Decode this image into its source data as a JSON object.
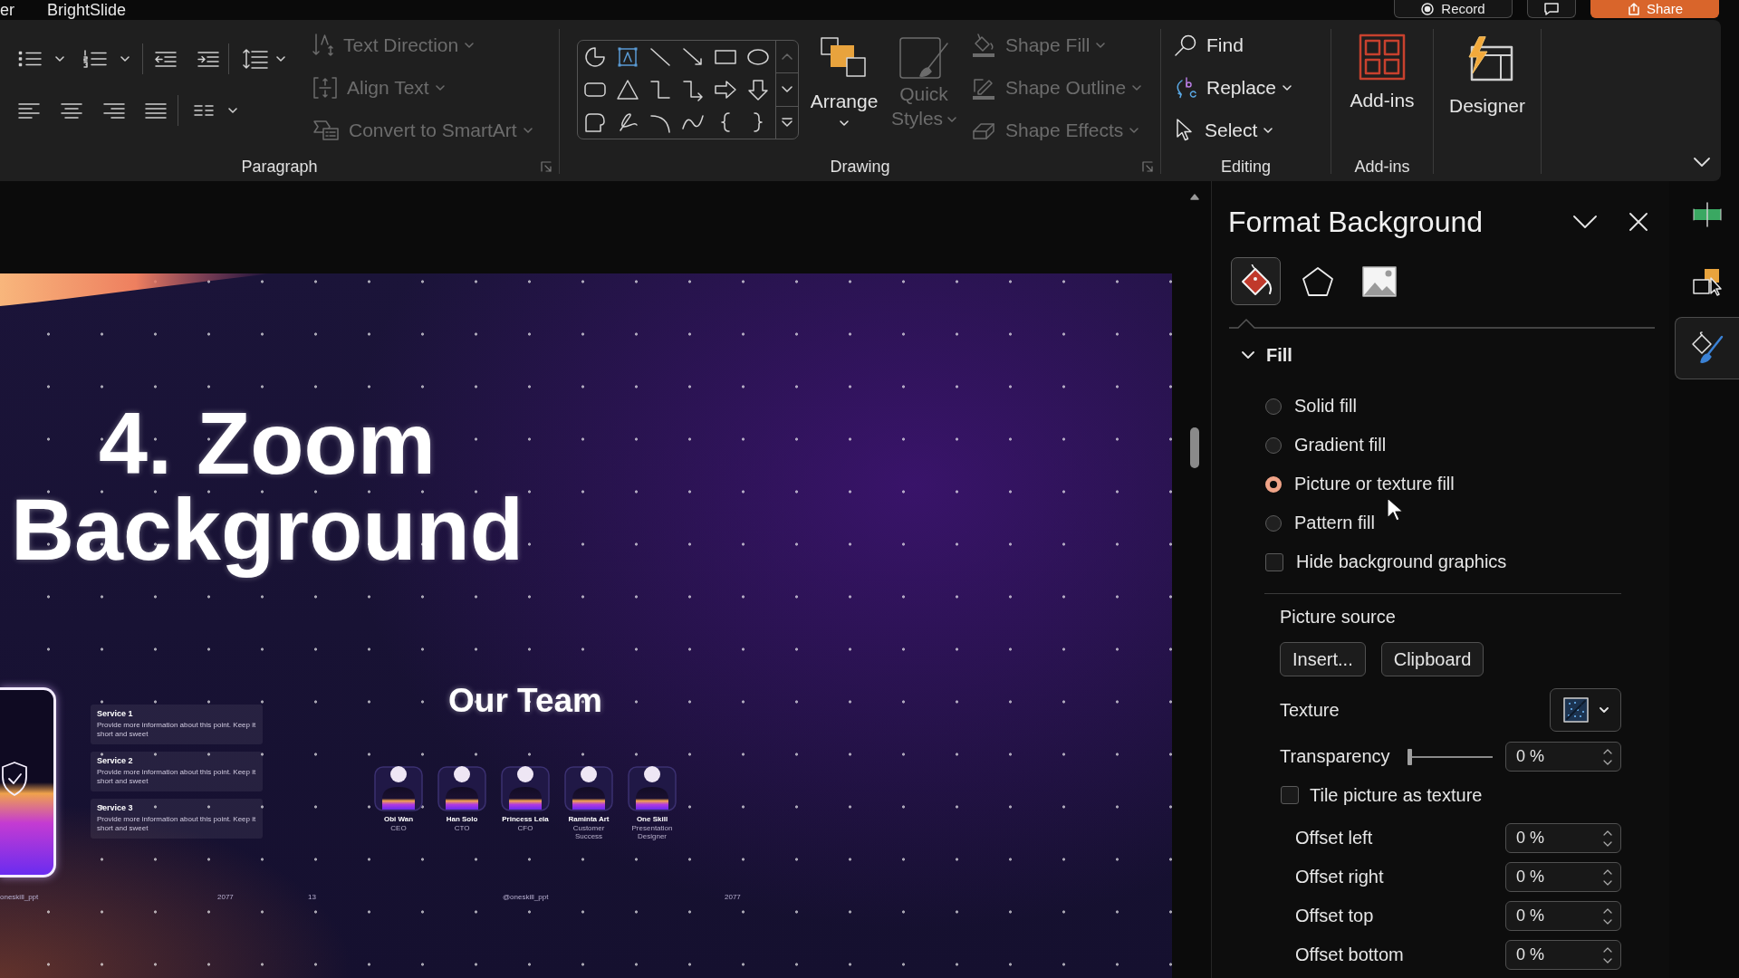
{
  "title_bar": {
    "tabs": [
      {
        "label": "er"
      },
      {
        "label": "BrightSlide"
      }
    ],
    "buttons": [
      {
        "kind": "record",
        "label": "Record"
      },
      {
        "kind": "comments"
      },
      {
        "kind": "share",
        "label": "Share"
      }
    ]
  },
  "ribbon": {
    "groups": [
      {
        "kind": "paragraph",
        "label": "Paragraph",
        "commands": [
          {
            "kind": "direction",
            "label": "Text Direction",
            "disabled": true,
            "dropdown": true
          },
          {
            "kind": "align",
            "label": "Align Text",
            "disabled": true,
            "dropdown": true
          },
          {
            "kind": "smartart",
            "label": "Convert to SmartArt",
            "disabled": true,
            "dropdown": true
          }
        ]
      },
      {
        "kind": "drawing",
        "label": "Drawing",
        "large": [
          {
            "kind": "arrange",
            "label": "Arrange",
            "disabled": false,
            "dropdown": true
          },
          {
            "kind": "styles",
            "label": "Quick Styles",
            "disabled": true,
            "dropdown": true
          }
        ],
        "commands": [
          {
            "kind": "fill",
            "label": "Shape Fill",
            "disabled": true,
            "dropdown": true
          },
          {
            "kind": "outline",
            "label": "Shape Outline",
            "disabled": true,
            "dropdown": true
          },
          {
            "kind": "effects",
            "label": "Shape Effects",
            "disabled": true,
            "dropdown": true
          }
        ]
      },
      {
        "kind": "editing",
        "label": "Editing",
        "commands": [
          {
            "kind": "find",
            "label": "Find",
            "disabled": false,
            "dropdown": false
          },
          {
            "kind": "replace",
            "label": "Replace",
            "disabled": false,
            "dropdown": true
          },
          {
            "kind": "select",
            "label": "Select",
            "disabled": false,
            "dropdown": true
          }
        ]
      },
      {
        "kind": "addins",
        "label": "Add-ins",
        "large": [
          {
            "kind": "addins",
            "label": "Add-ins",
            "disabled": false,
            "dropdown": false
          }
        ]
      },
      {
        "kind": "designer",
        "large": [
          {
            "kind": "designer",
            "label": "Designer",
            "disabled": false,
            "dropdown": false
          }
        ]
      }
    ]
  },
  "slide": {
    "title": "4. Zoom Background",
    "services": [
      {
        "title": "Service 1",
        "text": "Provide more information about this point. Keep it short and sweet"
      },
      {
        "title": "Service 2",
        "text": "Provide more information about this point. Keep it short and sweet"
      },
      {
        "title": "Service 3",
        "text": "Provide more information about this point. Keep it short and sweet"
      }
    ],
    "team": {
      "title": "Our Team",
      "members": [
        {
          "name": "Obi Wan",
          "role": "CEO"
        },
        {
          "name": "Han Solo",
          "role": "CTO"
        },
        {
          "name": "Princess Leia",
          "role": "CFO"
        },
        {
          "name": "Raminta Art",
          "role": "Customer Success"
        },
        {
          "name": "One Skill",
          "role": "Presentation Designer"
        }
      ]
    },
    "footer": [
      "oneskill_ppt",
      "2077",
      "13",
      "@oneskill_ppt",
      "2077"
    ]
  },
  "format_pane": {
    "title": "Format Background",
    "tabs": [
      {
        "kind": "fill",
        "selected": true
      },
      {
        "kind": "effects",
        "selected": false
      },
      {
        "kind": "picture",
        "selected": false
      }
    ],
    "fill_section": {
      "title": "Fill",
      "expanded": true
    },
    "fill_options": [
      {
        "label": "Solid fill",
        "selected": false
      },
      {
        "label": "Gradient fill",
        "selected": false
      },
      {
        "label": "Picture or texture fill",
        "selected": true
      },
      {
        "label": "Pattern fill",
        "selected": false
      }
    ],
    "hide_background_graphics": {
      "label": "Hide background graphics",
      "checked": false
    },
    "picture_source": {
      "label": "Picture source",
      "buttons": [
        "Insert...",
        "Clipboard"
      ]
    },
    "texture": {
      "label": "Texture"
    },
    "transparency": {
      "label": "Transparency",
      "level": 0,
      "value": "0 %"
    },
    "tile_as_texture": {
      "label": "Tile picture as texture",
      "checked": false
    },
    "offsets": [
      {
        "label": "Offset left",
        "value": "0 %"
      },
      {
        "label": "Offset right",
        "value": "0 %"
      },
      {
        "label": "Offset top",
        "value": "0 %"
      },
      {
        "label": "Offset bottom",
        "value": "0 %"
      }
    ]
  },
  "side_rail": [
    {
      "kind": "align",
      "selected": false
    },
    {
      "kind": "selection",
      "selected": false
    },
    {
      "kind": "format",
      "selected": true
    }
  ]
}
